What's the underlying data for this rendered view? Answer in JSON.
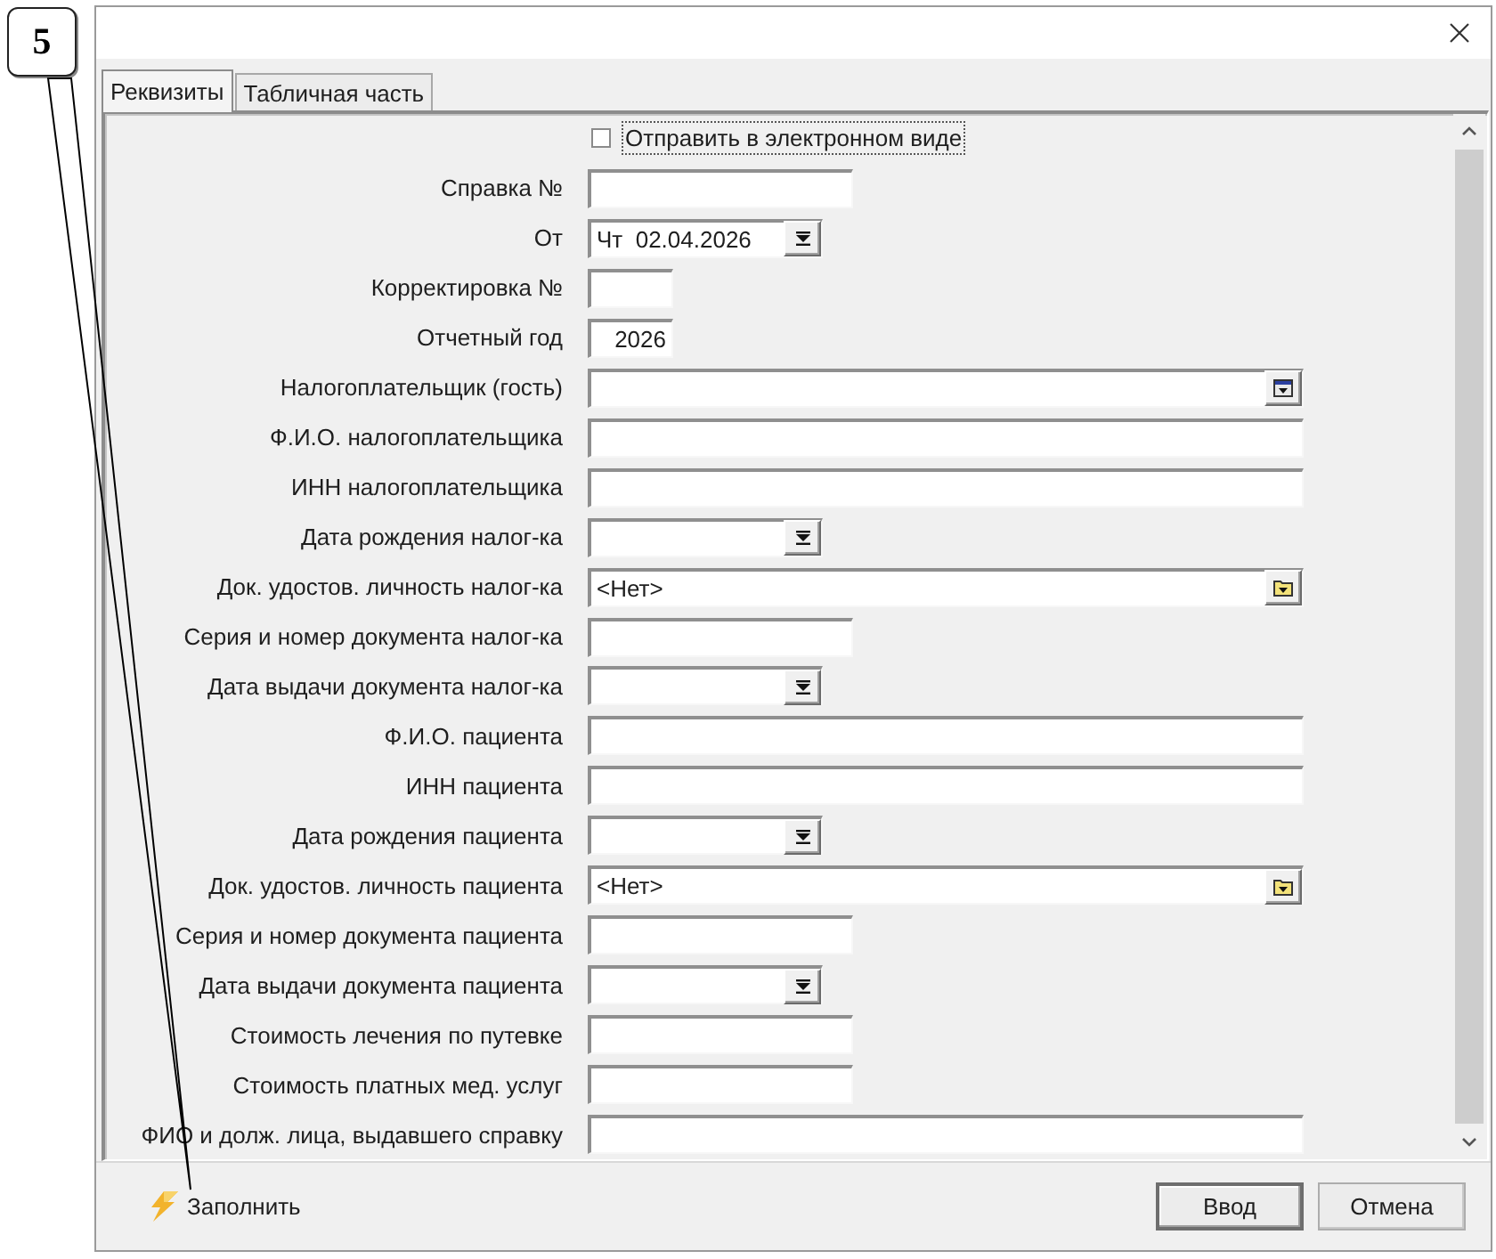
{
  "callout": {
    "label": "5"
  },
  "tabs": [
    {
      "label": "Реквизиты",
      "selected": true
    },
    {
      "label": "Табличная часть",
      "selected": false
    }
  ],
  "form": {
    "checkbox": {
      "label": "Отправить в электронном виде",
      "checked": false,
      "focused": true
    },
    "fields": [
      {
        "kind": "text",
        "label": "Справка №"
      },
      {
        "kind": "date",
        "label": "От",
        "value": "Чт  02.04.2026"
      },
      {
        "kind": "short",
        "label": "Корректировка №"
      },
      {
        "kind": "short",
        "label": "Отчетный год",
        "value": "2026"
      },
      {
        "kind": "lookup",
        "label": "Налогоплательщик (гость)"
      },
      {
        "kind": "wide",
        "label": "Ф.И.О. налогоплательщика"
      },
      {
        "kind": "wide",
        "label": "ИНН налогоплательщика"
      },
      {
        "kind": "date",
        "label": "Дата рождения налог-ка"
      },
      {
        "kind": "catalog",
        "label": "Док. удостов. личность налог-ка",
        "value": "<Нет>"
      },
      {
        "kind": "text",
        "label": "Серия и номер документа налог-ка"
      },
      {
        "kind": "date",
        "label": "Дата выдачи документа налог-ка"
      },
      {
        "kind": "wide",
        "label": "Ф.И.О. пациента"
      },
      {
        "kind": "wide",
        "label": "ИНН пациента"
      },
      {
        "kind": "date",
        "label": "Дата рождения пациента"
      },
      {
        "kind": "catalog",
        "label": "Док. удостов. личность пациента",
        "value": "<Нет>"
      },
      {
        "kind": "text",
        "label": "Серия и номер документа пациента"
      },
      {
        "kind": "date",
        "label": "Дата выдачи документа пациента"
      },
      {
        "kind": "text",
        "label": "Стоимость лечения по путевке"
      },
      {
        "kind": "text",
        "label": "Стоимость платных мед. услуг"
      },
      {
        "kind": "wide",
        "label": "ФИО и долж. лица, выдавшего справку"
      }
    ]
  },
  "footer": {
    "fill_button": {
      "label": "Заполнить"
    },
    "buttons": [
      {
        "label": "Ввод",
        "default": true
      },
      {
        "label": "Отмена",
        "default": false
      }
    ]
  }
}
